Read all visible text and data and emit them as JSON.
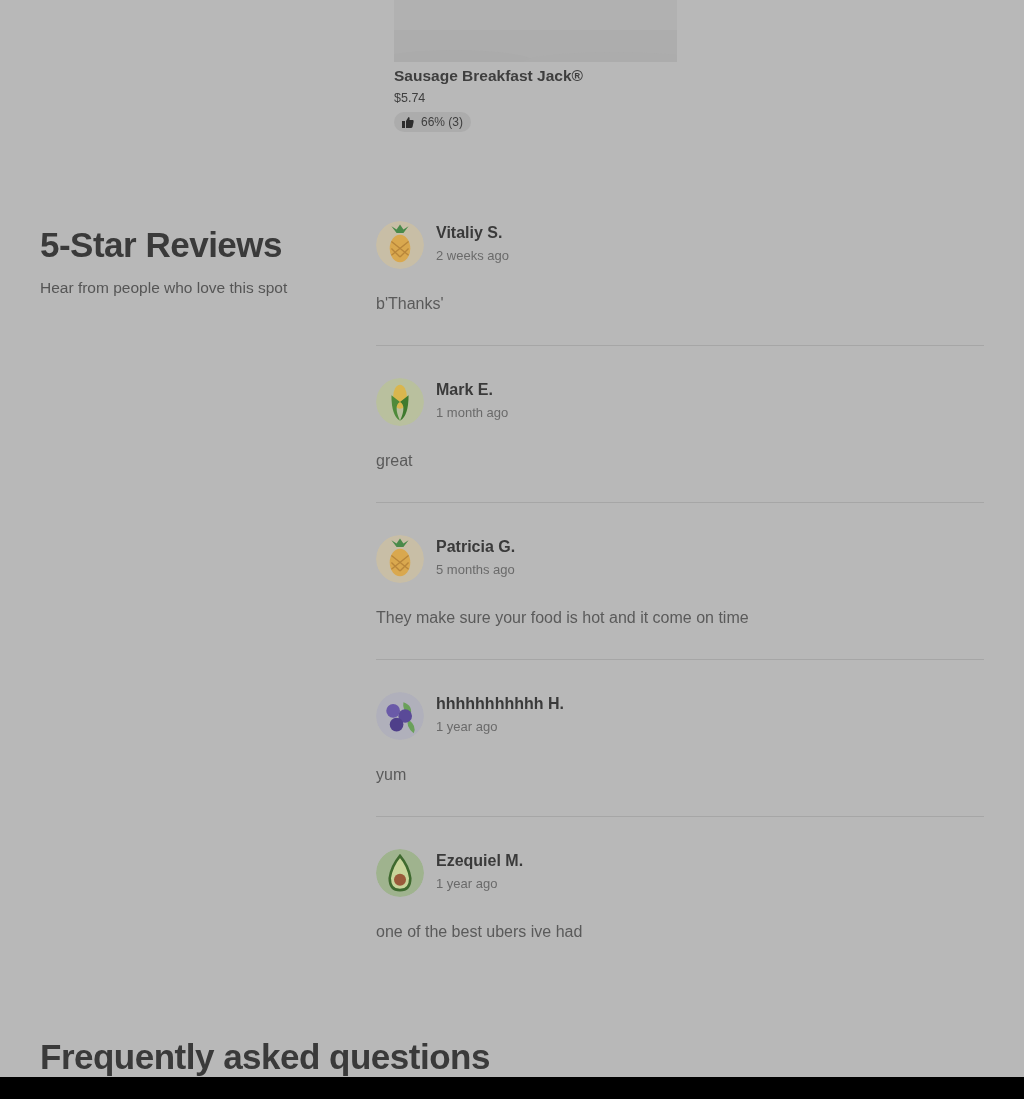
{
  "menu_item": {
    "kind": "picture",
    "name": "Sausage Breakfast Jack®",
    "price": "$5.74",
    "rating": "66% (3)"
  },
  "reviews_section": {
    "title": "5-Star Reviews",
    "subtitle": "Hear from people who love this spot",
    "reviews": [
      {
        "name": "Vitaliy S.",
        "time": "2 weeks ago",
        "text": "b'Thanks'",
        "kind": "pineapple"
      },
      {
        "name": "Mark E.",
        "time": "1 month ago",
        "text": "great",
        "kind": "corn"
      },
      {
        "name": "Patricia G.",
        "time": "5 months ago",
        "text": "They make sure your food is hot and it come on time",
        "kind": "pineapple"
      },
      {
        "name": "hhhhhhhhhhh H.",
        "time": "1 year ago",
        "text": "yum",
        "kind": "blueberry"
      },
      {
        "name": "Ezequiel M.",
        "time": "1 year ago",
        "text": "one of the best ubers ive had",
        "kind": "avocado"
      }
    ]
  },
  "faq": {
    "title": "Frequently asked questions"
  }
}
